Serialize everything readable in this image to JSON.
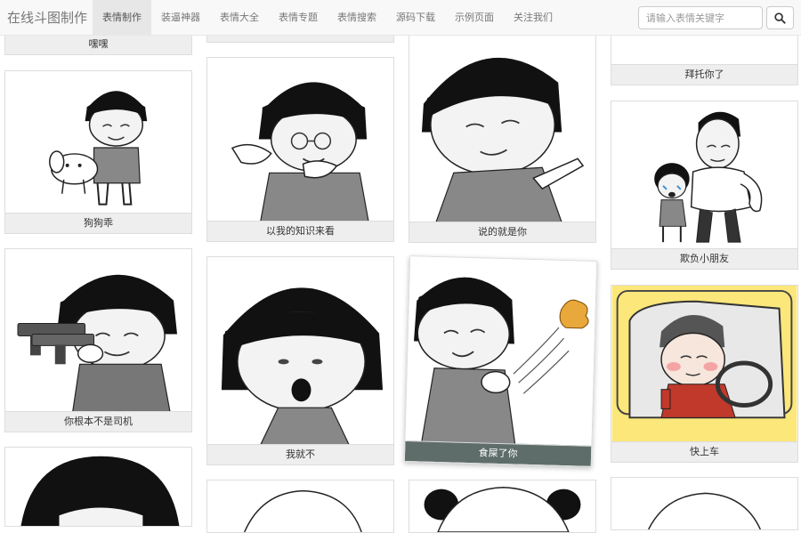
{
  "navbar": {
    "brand": "在线斗图制作",
    "items": [
      {
        "label": "表情制作",
        "active": true
      },
      {
        "label": "装逼神器"
      },
      {
        "label": "表情大全"
      },
      {
        "label": "表情专题"
      },
      {
        "label": "表情搜索"
      },
      {
        "label": "源码下载"
      },
      {
        "label": "示例页面"
      },
      {
        "label": "关注我们"
      }
    ],
    "search_placeholder": "请输入表情关键字",
    "search_icon": "search-icon"
  },
  "cards": [
    {
      "caption": "嘿嘿",
      "image": "mushroom-head-partial"
    },
    {
      "caption": "狗狗乖",
      "image": "mushroom-head-holding-dog"
    },
    {
      "caption": "你根本不是司机",
      "image": "mushroom-head-with-gun"
    },
    {
      "caption": "",
      "image": "mushroom-head-partial"
    },
    {
      "caption": "",
      "image": "mushroom-head-partial"
    },
    {
      "caption": "以我的知识来看",
      "image": "mushroom-head-with-glasses"
    },
    {
      "caption": "我就不",
      "image": "mushroom-head-shocked"
    },
    {
      "caption": "",
      "image": "mushroom-head-partial"
    },
    {
      "caption": "说的就是你",
      "image": "mushroom-head-pointing"
    },
    {
      "caption": "食屎了你",
      "image": "mushroom-head-throwing-poop"
    },
    {
      "caption": "",
      "image": "panda-head-partial"
    },
    {
      "caption": "拜托你了",
      "image": "mushroom-head-partial"
    },
    {
      "caption": "欺负小朋友",
      "image": "muscle-man-and-crying-kid"
    },
    {
      "caption": "快上车",
      "image": "man-driving-car"
    },
    {
      "caption": "",
      "image": "mushroom-head-partial"
    }
  ],
  "colors": {
    "navbar_bg": "#f8f8f8",
    "active_tab_bg": "#e7e7e7",
    "caption_bg": "#eeeeee",
    "dark_caption_bg": "#5e6d6a",
    "car_scene_bg": "#fbe77a"
  }
}
